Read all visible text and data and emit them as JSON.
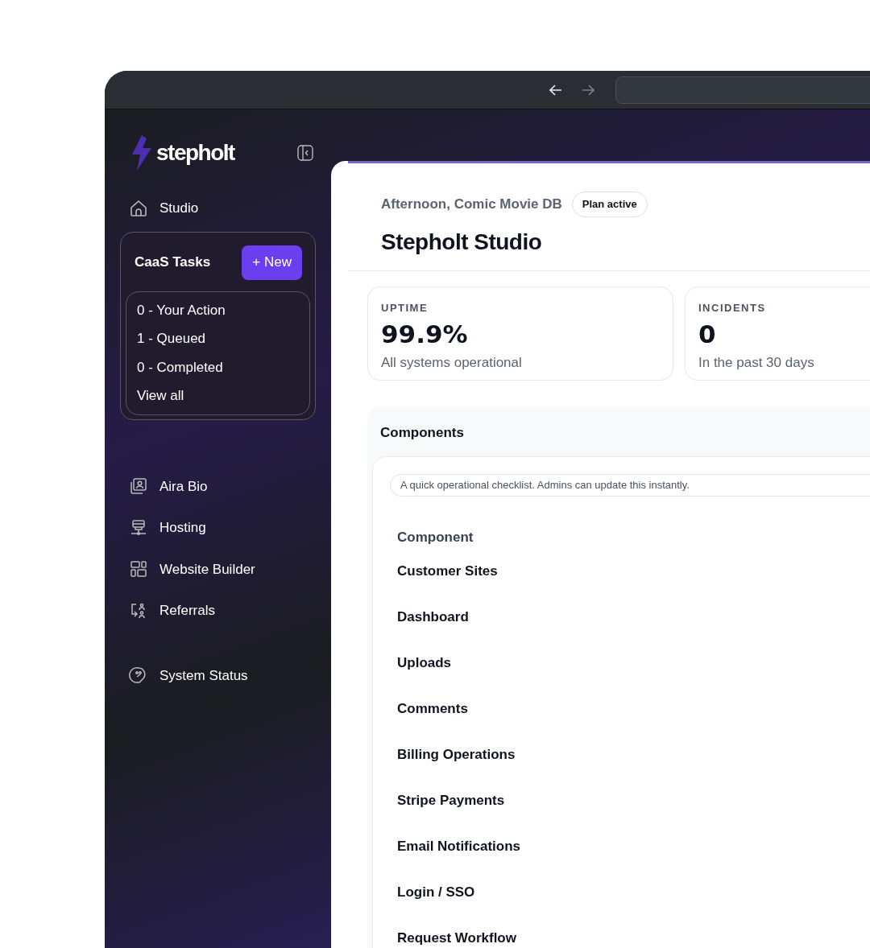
{
  "browser": {
    "nav_buttons": [
      {
        "kind": "back",
        "disabled": false
      },
      {
        "kind": "forward",
        "disabled": true
      }
    ]
  },
  "sidebar": {
    "brand": "stepholt",
    "home": {
      "label": "Studio"
    },
    "tasks": {
      "title": "CaaS Tasks",
      "new_button": "+ New",
      "items": [
        "0 - Your Action",
        "1 - Queued",
        "0 - Completed",
        "View all"
      ]
    },
    "items": [
      {
        "kind": "bio",
        "label": "Aira Bio"
      },
      {
        "kind": "hosting",
        "label": "Hosting"
      },
      {
        "kind": "builder",
        "label": "Website Builder"
      },
      {
        "kind": "referrals",
        "label": "Referrals"
      }
    ],
    "footer_items": [
      {
        "kind": "status",
        "label": "System Status"
      }
    ]
  },
  "header": {
    "greeting": "Afternoon, Comic Movie DB",
    "badge": "Plan active",
    "title": "Stepholt Studio"
  },
  "stats": [
    {
      "label": "UPTIME",
      "value": "99.9%",
      "caption": "All systems operational"
    },
    {
      "label": "INCIDENTS",
      "value": "0",
      "caption": "In the past 30 days"
    }
  ],
  "components": {
    "title": "Components",
    "note": "A quick operational checklist. Admins can update this instantly.",
    "columns": [
      "Component"
    ],
    "rows": [
      "Customer Sites",
      "Dashboard",
      "Uploads",
      "Comments",
      "Billing Operations",
      "Stripe Payments",
      "Email Notifications",
      "Login / SSO",
      "Request Workflow"
    ]
  }
}
